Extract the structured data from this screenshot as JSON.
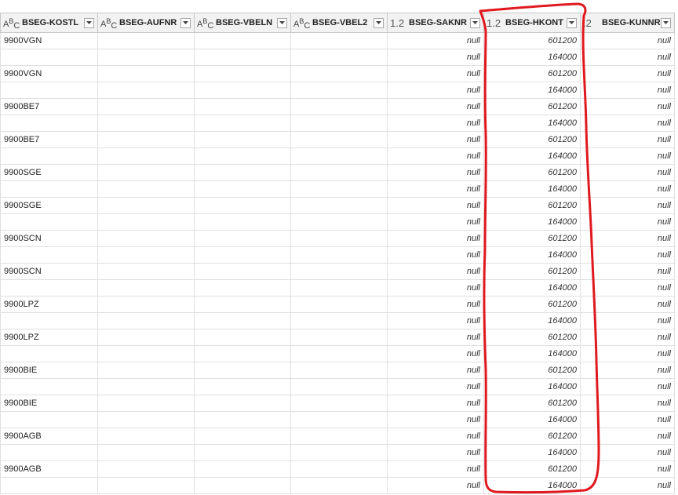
{
  "columns": [
    {
      "name": "BSEG-KOSTL",
      "type_icon": "abc-text-type-icon"
    },
    {
      "name": "BSEG-AUFNR",
      "type_icon": "abc-text-type-icon"
    },
    {
      "name": "BSEG-VBELN",
      "type_icon": "abc-text-type-icon"
    },
    {
      "name": "BSEG-VBEL2",
      "type_icon": "abc-text-type-icon"
    },
    {
      "name": "BSEG-SAKNR",
      "type_icon": "decimal-type-icon",
      "type_text": "1.2"
    },
    {
      "name": "BSEG-HKONT",
      "type_icon": "decimal-type-icon",
      "type_text": "1.2"
    },
    {
      "name": "BSEG-KUNNR",
      "type_icon": "decimal-type-icon",
      "type_text": ".2"
    }
  ],
  "rows": [
    [
      "9900VGN",
      "",
      "",
      "",
      "null",
      "601200",
      "null"
    ],
    [
      "",
      "",
      "",
      "",
      "null",
      "164000",
      "null"
    ],
    [
      "9900VGN",
      "",
      "",
      "",
      "null",
      "601200",
      "null"
    ],
    [
      "",
      "",
      "",
      "",
      "null",
      "164000",
      "null"
    ],
    [
      "9900BE7",
      "",
      "",
      "",
      "null",
      "601200",
      "null"
    ],
    [
      "",
      "",
      "",
      "",
      "null",
      "164000",
      "null"
    ],
    [
      "9900BE7",
      "",
      "",
      "",
      "null",
      "601200",
      "null"
    ],
    [
      "",
      "",
      "",
      "",
      "null",
      "164000",
      "null"
    ],
    [
      "9900SGE",
      "",
      "",
      "",
      "null",
      "601200",
      "null"
    ],
    [
      "",
      "",
      "",
      "",
      "null",
      "164000",
      "null"
    ],
    [
      "9900SGE",
      "",
      "",
      "",
      "null",
      "601200",
      "null"
    ],
    [
      "",
      "",
      "",
      "",
      "null",
      "164000",
      "null"
    ],
    [
      "9900SCN",
      "",
      "",
      "",
      "null",
      "601200",
      "null"
    ],
    [
      "",
      "",
      "",
      "",
      "null",
      "164000",
      "null"
    ],
    [
      "9900SCN",
      "",
      "",
      "",
      "null",
      "601200",
      "null"
    ],
    [
      "",
      "",
      "",
      "",
      "null",
      "164000",
      "null"
    ],
    [
      "9900LPZ",
      "",
      "",
      "",
      "null",
      "601200",
      "null"
    ],
    [
      "",
      "",
      "",
      "",
      "null",
      "164000",
      "null"
    ],
    [
      "9900LPZ",
      "",
      "",
      "",
      "null",
      "601200",
      "null"
    ],
    [
      "",
      "",
      "",
      "",
      "null",
      "164000",
      "null"
    ],
    [
      "9900BIE",
      "",
      "",
      "",
      "null",
      "601200",
      "null"
    ],
    [
      "",
      "",
      "",
      "",
      "null",
      "164000",
      "null"
    ],
    [
      "9900BIE",
      "",
      "",
      "",
      "null",
      "601200",
      "null"
    ],
    [
      "",
      "",
      "",
      "",
      "null",
      "164000",
      "null"
    ],
    [
      "9900AGB",
      "",
      "",
      "",
      "null",
      "601200",
      "null"
    ],
    [
      "",
      "",
      "",
      "",
      "null",
      "164000",
      "null"
    ],
    [
      "9900AGB",
      "",
      "",
      "",
      "null",
      "601200",
      "null"
    ],
    [
      "",
      "",
      "",
      "",
      "null",
      "164000",
      "null"
    ]
  ],
  "annotation": {
    "color": "#e0191f"
  }
}
